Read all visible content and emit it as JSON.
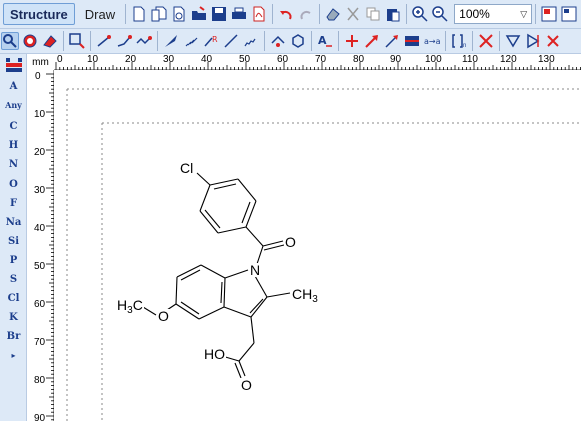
{
  "toolbar": {
    "mode_tabs": [
      {
        "label": "Structure",
        "active": true
      },
      {
        "label": "Draw",
        "active": false
      }
    ],
    "zoom": {
      "value": "100%"
    }
  },
  "rulers": {
    "unit": "mm",
    "horizontal_ticks": [
      "0",
      "10",
      "20",
      "30",
      "40",
      "50",
      "60",
      "70",
      "80",
      "90",
      "100",
      "110",
      "120",
      "130"
    ],
    "vertical_ticks": [
      "0",
      "10",
      "20",
      "30",
      "40",
      "50",
      "60",
      "70",
      "80",
      "90"
    ]
  },
  "element_palette": [
    "A",
    "Any",
    "C",
    "H",
    "N",
    "O",
    "F",
    "Na",
    "Si",
    "P",
    "S",
    "Cl",
    "K",
    "Br"
  ],
  "molecule": {
    "atom_labels": {
      "cl": "Cl",
      "carbonyl_o": "O",
      "n": "N",
      "methyl_c": "CH",
      "methyl_sub": "3",
      "methoxy_o": "O",
      "methoxy_c": "H",
      "methoxy_sub": "3",
      "methoxy_c2": "C",
      "acid_ho": "HO",
      "acid_o": "O"
    }
  },
  "colors": {
    "toolbar_bg": "#dde9f7",
    "accent": "#1c3e8c",
    "active_tab_border": "#6f9ed6"
  }
}
